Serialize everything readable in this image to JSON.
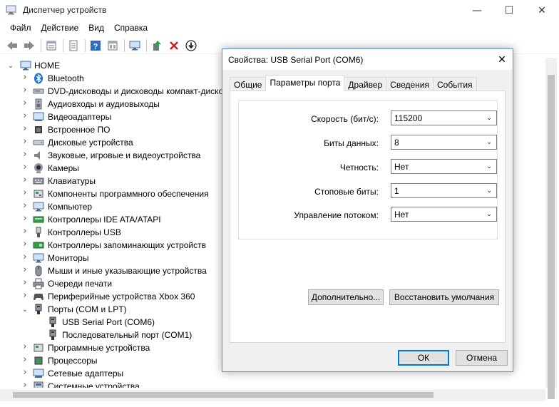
{
  "window": {
    "title": "Диспетчер устройств",
    "minimize": "—",
    "maximize": "☐",
    "close": "✕"
  },
  "menu": [
    "Файл",
    "Действие",
    "Вид",
    "Справка"
  ],
  "toolbar": {
    "icons": [
      "back-icon",
      "forward-icon",
      "properties-icon",
      "details-icon",
      "help-icon",
      "view-icon",
      "monitor-icon",
      "update-driver-icon",
      "uninstall-icon",
      "download-icon"
    ]
  },
  "tree": {
    "root": "HOME",
    "items": [
      {
        "label": "Bluetooth",
        "icon": "bluetooth-icon",
        "expanded": false
      },
      {
        "label": "DVD-дисководы и дисководы компакт-дисков",
        "icon": "dvd-icon",
        "expanded": false
      },
      {
        "label": "Аудиовходы и аудиовыходы",
        "icon": "speaker-icon",
        "expanded": false
      },
      {
        "label": "Видеоадаптеры",
        "icon": "display-adapter-icon",
        "expanded": false
      },
      {
        "label": "Встроенное ПО",
        "icon": "firmware-icon",
        "expanded": false
      },
      {
        "label": "Дисковые устройства",
        "icon": "disk-icon",
        "expanded": false
      },
      {
        "label": "Звуковые, игровые и видеоустройства",
        "icon": "sound-icon",
        "expanded": false
      },
      {
        "label": "Камеры",
        "icon": "camera-icon",
        "expanded": false
      },
      {
        "label": "Клавиатуры",
        "icon": "keyboard-icon",
        "expanded": false
      },
      {
        "label": "Компоненты программного обеспечения",
        "icon": "software-component-icon",
        "expanded": false
      },
      {
        "label": "Компьютер",
        "icon": "computer-icon",
        "expanded": false
      },
      {
        "label": "Контроллеры IDE ATA/ATAPI",
        "icon": "ide-controller-icon",
        "expanded": false
      },
      {
        "label": "Контроллеры USB",
        "icon": "usb-icon",
        "expanded": false
      },
      {
        "label": "Контроллеры запоминающих устройств",
        "icon": "storage-controller-icon",
        "expanded": false
      },
      {
        "label": "Мониторы",
        "icon": "monitor-icon",
        "expanded": false
      },
      {
        "label": "Мыши и иные указывающие устройства",
        "icon": "mouse-icon",
        "expanded": false
      },
      {
        "label": "Очереди печати",
        "icon": "printer-icon",
        "expanded": false
      },
      {
        "label": "Периферийные устройства Xbox 360",
        "icon": "gamepad-icon",
        "expanded": false
      },
      {
        "label": "Порты (COM и LPT)",
        "icon": "port-icon",
        "expanded": true
      },
      {
        "label": "USB Serial Port (COM6)",
        "icon": "port-icon",
        "child": true
      },
      {
        "label": "Последовательный порт (COM1)",
        "icon": "port-icon",
        "child": true
      },
      {
        "label": "Программные устройства",
        "icon": "software-device-icon",
        "expanded": false
      },
      {
        "label": "Процессоры",
        "icon": "cpu-icon",
        "expanded": false
      },
      {
        "label": "Сетевые адаптеры",
        "icon": "network-icon",
        "expanded": false
      },
      {
        "label": "Системные устройства",
        "icon": "system-icon",
        "expanded": false
      }
    ]
  },
  "dialog": {
    "title": "Свойства: USB Serial Port (COM6)",
    "close": "✕",
    "tabs": [
      "Общие",
      "Параметры порта",
      "Драйвер",
      "Сведения",
      "События"
    ],
    "active_tab": "Параметры порта",
    "fields": [
      {
        "label": "Скорость (бит/с):",
        "value": "115200"
      },
      {
        "label": "Биты данных:",
        "value": "8"
      },
      {
        "label": "Четность:",
        "value": "Нет"
      },
      {
        "label": "Стоповые биты:",
        "value": "1"
      },
      {
        "label": "Управление потоком:",
        "value": "Нет"
      }
    ],
    "advanced_button": "Дополнительно...",
    "restore_button": "Восстановить умолчания",
    "ok_button": "ОК",
    "cancel_button": "Отмена"
  },
  "colors": {
    "accent": "#0078d7",
    "dialog_border": "#5a8fd6",
    "dialog_bg": "#f0f0f0"
  }
}
